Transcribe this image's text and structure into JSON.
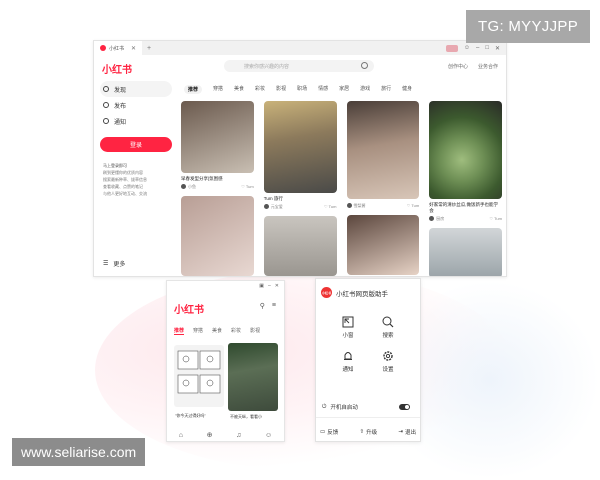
{
  "overlay": {
    "tg_label": "TG: MYYJJPP",
    "watermark": "www.seliarise.com"
  },
  "browser": {
    "tab_title": "小红书",
    "logo": "小红书",
    "search_placeholder": "搜索你感兴趣的内容",
    "top_links": [
      "创作中心",
      "业务合作"
    ],
    "sidebar": {
      "items": [
        {
          "label": "发现",
          "icon": "compass-icon"
        },
        {
          "label": "发布",
          "icon": "plus-circle-icon"
        },
        {
          "label": "通知",
          "icon": "bell-icon"
        }
      ],
      "login_label": "登录",
      "list": [
        "马上登录即可",
        "刷到更懂你的优质内容",
        "搜索最新种草、拔草信息",
        "查看收藏、点赞的笔记",
        "与他人更好地互动、交流"
      ],
      "more_label": "更多"
    },
    "channels": [
      "推荐",
      "穿搭",
      "美食",
      "彩妆",
      "影视",
      "职场",
      "情感",
      "家居",
      "游戏",
      "旅行",
      "健身"
    ],
    "feed": [
      [
        {
          "title": "早春发型分享|氛围感",
          "author": "小鱼",
          "likes": "Tum",
          "color1": "#6b5a4e",
          "color2": "#c9bfb3"
        },
        {
          "title": "",
          "author": "",
          "likes": "",
          "color1": "#b89e95",
          "color2": "#e8d8d2"
        }
      ],
      [
        {
          "title": "Tum 旅行",
          "author": "元宝爱",
          "likes": "Tum",
          "color1": "#8c7a5c",
          "color2": "#4a4a48"
        },
        {
          "title": "",
          "author": "",
          "likes": "",
          "color1": "#c9c5bf",
          "color2": "#9a9690"
        }
      ],
      [
        {
          "title": "",
          "author": "雪梨酱",
          "likes": "Tum",
          "color1": "#4a3e38",
          "color2": "#d8c6b8"
        },
        {
          "title": "",
          "author": "",
          "likes": "",
          "color1": "#5b463d",
          "color2": "#e7d3c6"
        }
      ],
      [
        {
          "title": "好家常的清炒丝瓜,做饭新手也能学会",
          "author": "厨房",
          "likes": "Tum",
          "color1": "#3c5a2e",
          "color2": "#9fbd7e"
        },
        {
          "title": "",
          "author": "",
          "likes": "",
          "color1": "#9aa3a8",
          "color2": "#d2d6d8"
        }
      ]
    ]
  },
  "phone": {
    "logo": "小红书",
    "channels": [
      "推荐",
      "穿搭",
      "美食",
      "彩妆",
      "影视"
    ],
    "caption1": "\"你今天过得好吗\"",
    "caption2": "不被天纵，看看小"
  },
  "panel": {
    "title": "小红书网页版助手",
    "logo_text": "小红书",
    "grid": [
      {
        "label": "小窗",
        "icon": "mini-window-icon"
      },
      {
        "label": "搜索",
        "icon": "search-icon"
      },
      {
        "label": "通知",
        "icon": "bell-icon"
      },
      {
        "label": "设置",
        "icon": "gear-icon"
      }
    ],
    "autostart_label": "开机自启动",
    "footer": [
      "反馈",
      "升级",
      "退出"
    ]
  }
}
